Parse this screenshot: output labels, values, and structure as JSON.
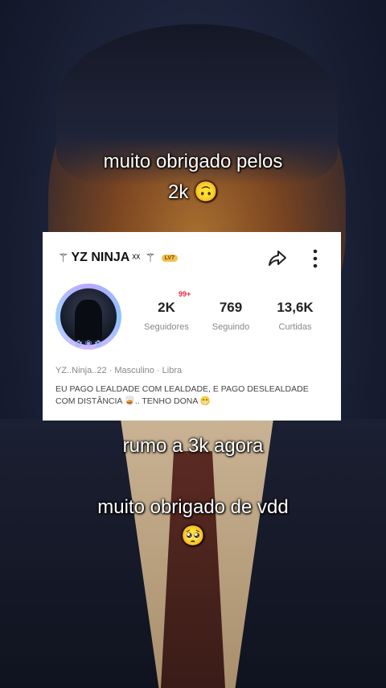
{
  "captions": {
    "top_line1": "muito obrigado pelos",
    "top_line2": "2k 🙃",
    "middle": "rumo a 3k agora",
    "bottom_line1": "muito obrigado de vdd",
    "bottom_line2": "🥺"
  },
  "profile": {
    "symbol_left": "⚚",
    "name": "YZ NINJA",
    "name_suffix": "ˣˣ",
    "symbol_right": "⚚",
    "level_badge": "LV7",
    "notification_badge": "99+",
    "stats": [
      {
        "value": "2K",
        "label": "Seguidores"
      },
      {
        "value": "769",
        "label": "Seguindo"
      },
      {
        "value": "13,6K",
        "label": "Curtidas"
      }
    ],
    "meta": "YZ..Ninja..22  ·  Masculino  ·  Libra",
    "bio": "EU PAGO LEALDADE COM LEALDADE, E PAGO DESLEALDADE COM DISTÂNCIA 🥃.. TENHO DONA 😁"
  }
}
